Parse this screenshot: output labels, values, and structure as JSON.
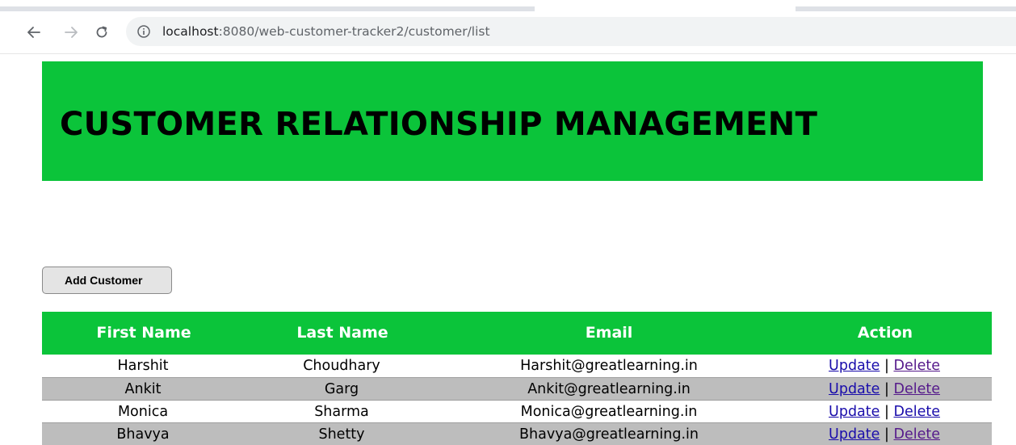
{
  "browser": {
    "url_host": "localhost",
    "url_path": ":8080/web-customer-tracker2/customer/list"
  },
  "header": {
    "title": "CUSTOMER RELATIONSHIP MANAGEMENT",
    "background_color": "#0bc43a"
  },
  "actions": {
    "add_customer_label": "Add Customer"
  },
  "table": {
    "columns": [
      "First Name",
      "Last Name",
      "Email",
      "Action"
    ],
    "header_color": "#0bc43a",
    "rows": [
      {
        "first_name": "Harshit",
        "last_name": "Choudhary",
        "email": "Harshit@greatlearning.in",
        "update": "Update",
        "separator": "|",
        "delete": "Delete"
      },
      {
        "first_name": "Ankit",
        "last_name": "Garg",
        "email": "Ankit@greatlearning.in",
        "update": "Update",
        "separator": "|",
        "delete": "Delete"
      },
      {
        "first_name": "Monica",
        "last_name": "Sharma",
        "email": "Monica@greatlearning.in",
        "update": "Update",
        "separator": "|",
        "delete": "Delete"
      },
      {
        "first_name": "Bhavya",
        "last_name": "Shetty",
        "email": "Bhavya@greatlearning.in",
        "update": "Update",
        "separator": "|",
        "delete": "Delete"
      }
    ]
  },
  "icons": {
    "back": "back-arrow-icon",
    "forward": "forward-arrow-icon",
    "reload": "reload-icon",
    "site_info": "info-icon"
  }
}
